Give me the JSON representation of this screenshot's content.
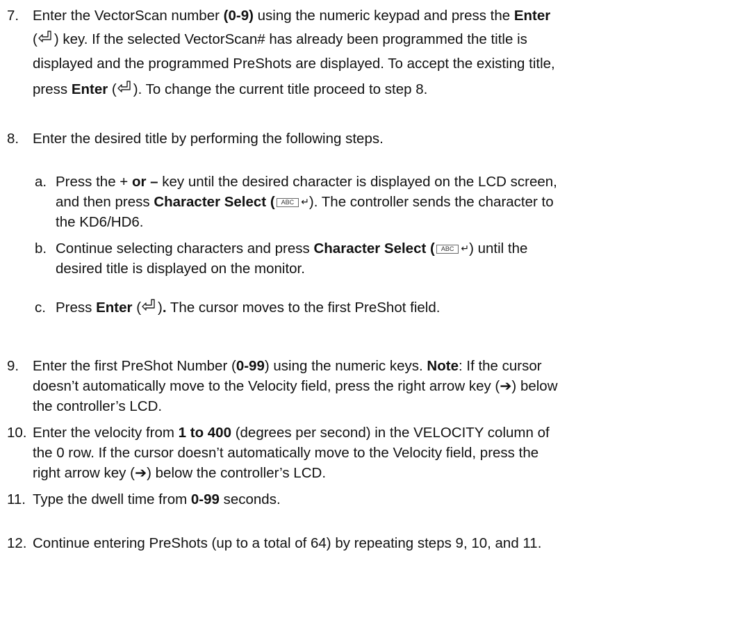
{
  "steps": [
    {
      "number": "7.",
      "lines": [
        [
          "Enter the VectorScan number ",
          {
            "b": "(0-9)"
          },
          " using the numeric keypad and press the ",
          {
            "b": "Enter"
          }
        ],
        [
          "(",
          {
            "icon": "enter"
          },
          ") key.  If the selected VectorScan# has already been programmed the title is"
        ],
        [
          "displayed and the programmed PreShots are displayed.  To accept the existing title,"
        ],
        [
          "press ",
          {
            "b": "Enter"
          },
          " (",
          {
            "icon": "enter"
          },
          ").  To change the current title proceed to step 8."
        ]
      ]
    },
    {
      "number": "8.",
      "lines": [
        [
          "Enter the desired title by performing the following steps."
        ]
      ]
    },
    {
      "number": "a.",
      "sub": true,
      "lines": [
        [
          "Press the + ",
          {
            "b": "or –"
          },
          " key until the desired character is displayed on the LCD screen,"
        ],
        [
          "and then press ",
          {
            "b": "Character Select ("
          },
          {
            "icon": "abc"
          },
          ").  The controller sends the character to"
        ],
        [
          "the KD6/HD6."
        ]
      ]
    },
    {
      "number": "b.",
      "sub": true,
      "lines": [
        [
          "Continue selecting characters and press ",
          {
            "b": "Character Select ("
          },
          {
            "icon": "abc"
          },
          ") until the"
        ],
        [
          "desired title is displayed on the monitor."
        ]
      ]
    },
    {
      "number": "c.",
      "sub": true,
      "lines": [
        [
          "Press ",
          {
            "b": "Enter"
          },
          " (",
          {
            "icon": "enter"
          },
          ")",
          {
            "b": "."
          },
          "  The cursor moves to the first PreShot field."
        ]
      ]
    },
    {
      "number": "9.",
      "lines": [
        [
          "Enter the first PreShot Number (",
          {
            "b": "0-99"
          },
          ") using the numeric keys.  ",
          {
            "b": "Note"
          },
          ":  If the cursor"
        ],
        [
          "doesn’t automatically move to the Velocity field, press the right arrow key (➔) below"
        ],
        [
          "the controller’s LCD."
        ]
      ]
    },
    {
      "number": "10.",
      "lines": [
        [
          "Enter the velocity from ",
          {
            "b": "1 to 400"
          },
          " (degrees per second) in the VELOCITY column of"
        ],
        [
          "the 0 row.  If the cursor doesn’t automatically move to the Velocity field, press the"
        ],
        [
          "right arrow key (➔) below the controller’s LCD."
        ]
      ]
    },
    {
      "number": "11.",
      "lines": [
        [
          "Type the dwell time from ",
          {
            "b": "0-99"
          },
          " seconds."
        ]
      ]
    },
    {
      "number": "12.",
      "lines": [
        [
          "Continue entering PreShots (up to a total of 64) by repeating steps 9, 10, and 11."
        ]
      ]
    }
  ],
  "icons": {
    "abc_key_label": "ABC",
    "return_glyph": "↵"
  }
}
